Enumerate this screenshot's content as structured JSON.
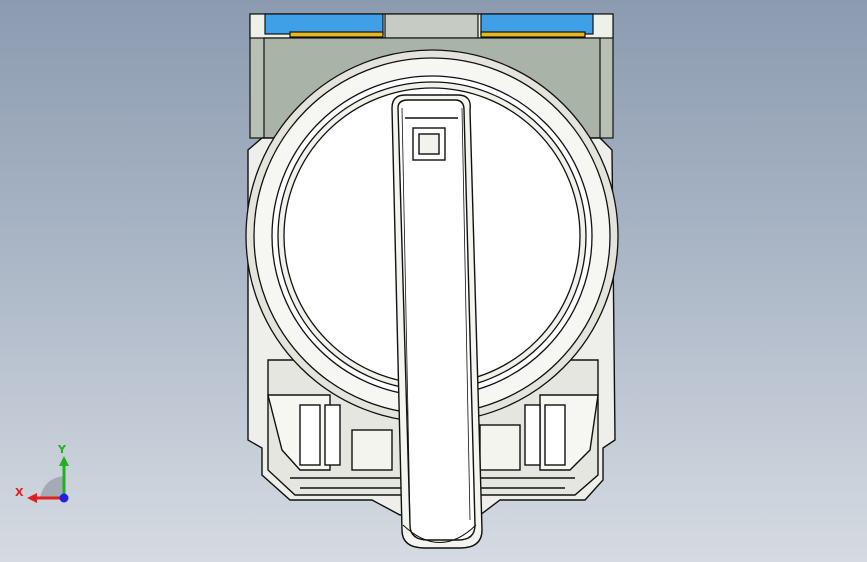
{
  "viewport": {
    "background_top": "#8c9bb0",
    "background_bottom": "#d6dbe2"
  },
  "model": {
    "part": "rotary-selector-switch",
    "body_color": "#f4f4f1",
    "shadow_color": "#c9c9c2",
    "housing_color": "#b8c0b4",
    "cap_color": "#d0d0c8",
    "band_blue": "#3fa0e8",
    "band_yellow": "#e8b820",
    "edge_color": "#111111"
  },
  "triad": {
    "x_label": "X",
    "y_label": "Y",
    "x_color": "#e02020",
    "y_color": "#20b020",
    "z_color": "#2020e0"
  }
}
